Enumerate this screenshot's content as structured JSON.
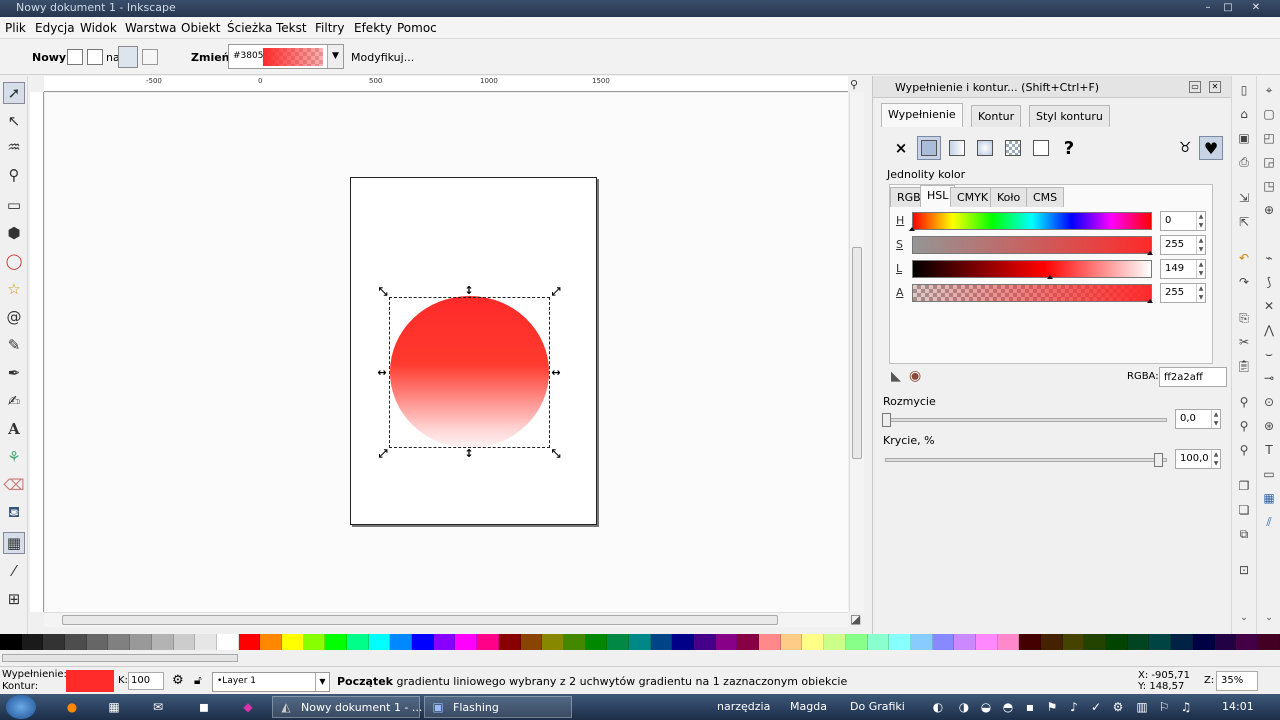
{
  "window": {
    "title": "Nowy dokument 1 - Inkscape"
  },
  "menu": [
    "Plik",
    "Edycja",
    "Widok",
    "Warstwa",
    "Obiekt",
    "Ścieżka",
    "Tekst",
    "Filtry",
    "Efekty",
    "Pomoc"
  ],
  "toolbar": {
    "new_label": "Nowy:",
    "on_label": "na",
    "change_label": "Zmień:",
    "gradient_id": "#3805",
    "modify_label": "Modyfikuj..."
  },
  "ruler": {
    "top_labels": [
      "-500",
      "0",
      "500",
      "1000",
      "1500"
    ]
  },
  "dialog": {
    "title": "Wypełnienie i kontur... (Shift+Ctrl+F)",
    "tabs": [
      "Wypełnienie",
      "Kontur",
      "Styl konturu"
    ],
    "paint_none": "×",
    "paint_unknown": "?",
    "flat_color_label": "Jednolity kolor",
    "color_tabs": [
      "RGB",
      "HSL",
      "CMYK",
      "Koło",
      "CMS"
    ],
    "channels": [
      {
        "label": "H",
        "value": "0",
        "level": 0.0
      },
      {
        "label": "S",
        "value": "255",
        "level": 1.0
      },
      {
        "label": "L",
        "value": "149",
        "level": 0.58
      },
      {
        "label": "A",
        "value": "255",
        "level": 1.0
      }
    ],
    "rgba_label": "RGBA:",
    "rgba_value": "ff2a2aff",
    "blur_label": "Rozmycie",
    "blur_value": "0,0",
    "blur_level": 0.0,
    "opacity_label": "Krycie, %",
    "opacity_value": "100,0",
    "opacity_level": 1.0
  },
  "colors": {
    "fill": "#ff2a2a",
    "accent": "#2f4a6e"
  },
  "status": {
    "fill_label": "Wypełnienie:",
    "stroke_label": "Kontur:",
    "opacity_label": "K:",
    "opacity_value": "100",
    "layer": "•Layer 1",
    "message_bold": "Początek",
    "message": " gradientu liniowego wybrany z 2 uchwytów gradientu na 1 zaznaczonym obiekcie",
    "x_coord": "X: -905,71",
    "y_coord": "Y:  148,57",
    "zoom_label": "Z:",
    "zoom_value": "35%"
  },
  "taskbar": {
    "windows": [
      "Nowy dokument 1 - ...",
      "Flashing"
    ],
    "tray_items": [
      "narzędzia",
      "Magda",
      "Do Grafiki"
    ],
    "clock": "14:01"
  }
}
